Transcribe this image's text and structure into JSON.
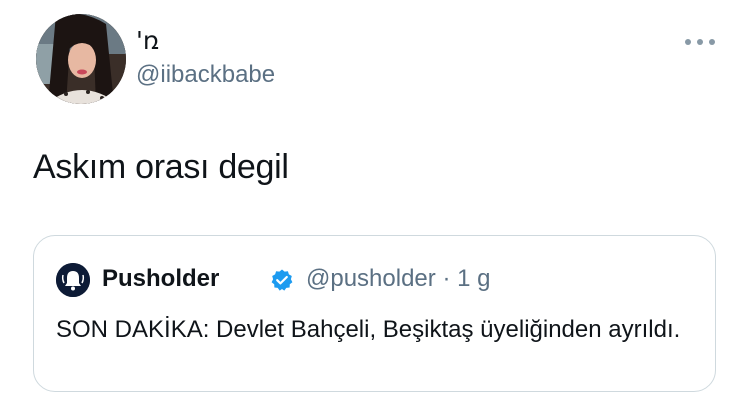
{
  "author": {
    "display_name": "'ռ",
    "handle": "@iibackbabe"
  },
  "tweet": {
    "text": "Askım orası degil"
  },
  "quoted_tweet": {
    "display_name": "Pusholder",
    "handle": "@pusholder",
    "separator": "·",
    "time": "1 g",
    "text": "SON DAKİKA: Devlet Bahçeli, Beşiktaş üyeliğinden ayrıldı."
  },
  "icons": {
    "more": "more-horizontal-icon",
    "verified": "verified-badge-icon",
    "quote_avatar": "bell-icon"
  },
  "colors": {
    "text_primary": "#0f1419",
    "text_secondary": "#5b7083",
    "verified": "#1d9bf0",
    "border": "#cfd9de",
    "quote_avatar_bg": "#0d1b36"
  }
}
